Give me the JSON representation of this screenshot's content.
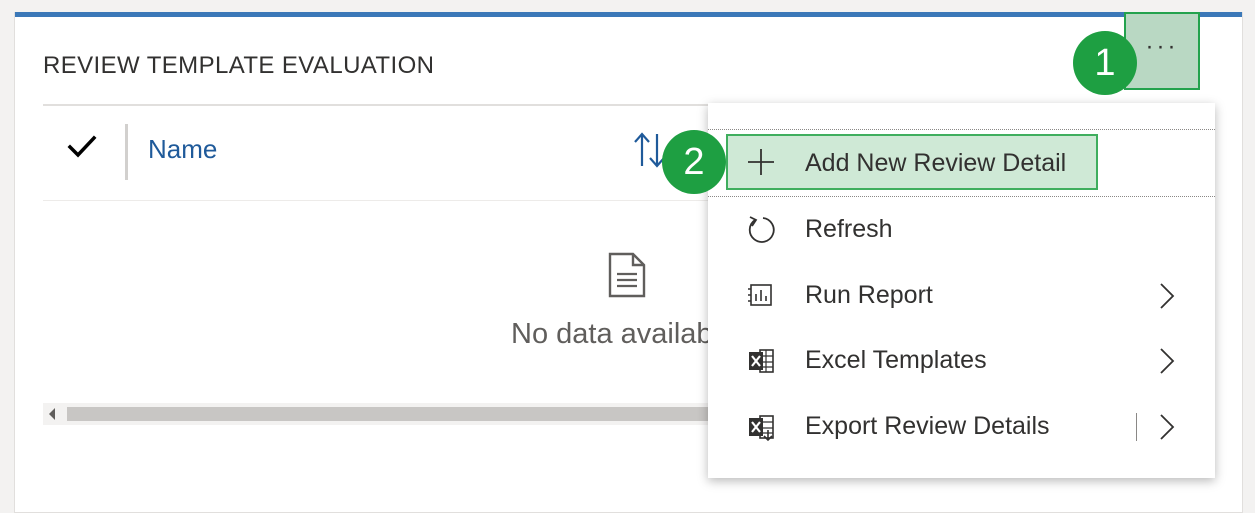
{
  "section": {
    "title": "REVIEW TEMPLATE EVALUATION"
  },
  "grid": {
    "columns": [
      {
        "label": "Name"
      }
    ],
    "empty_message": "No data availab"
  },
  "more_button": {
    "label": "···"
  },
  "badges": {
    "first": "1",
    "second": "2"
  },
  "menu": {
    "items": [
      {
        "label": "Add New Review Detail",
        "icon": "plus-icon"
      },
      {
        "label": "Refresh",
        "icon": "refresh-icon"
      },
      {
        "label": "Run Report",
        "icon": "report-icon",
        "submenu": true
      },
      {
        "label": "Excel Templates",
        "icon": "excel-icon",
        "submenu": true
      },
      {
        "label": "Export Review Details",
        "icon": "excel-export-icon",
        "submenu": true
      }
    ]
  },
  "colors": {
    "accent_bar": "#3b78b8",
    "link_blue": "#1f5a9a",
    "annotation_green": "#1e9f42",
    "highlight_fill": "#cfe9d6"
  }
}
